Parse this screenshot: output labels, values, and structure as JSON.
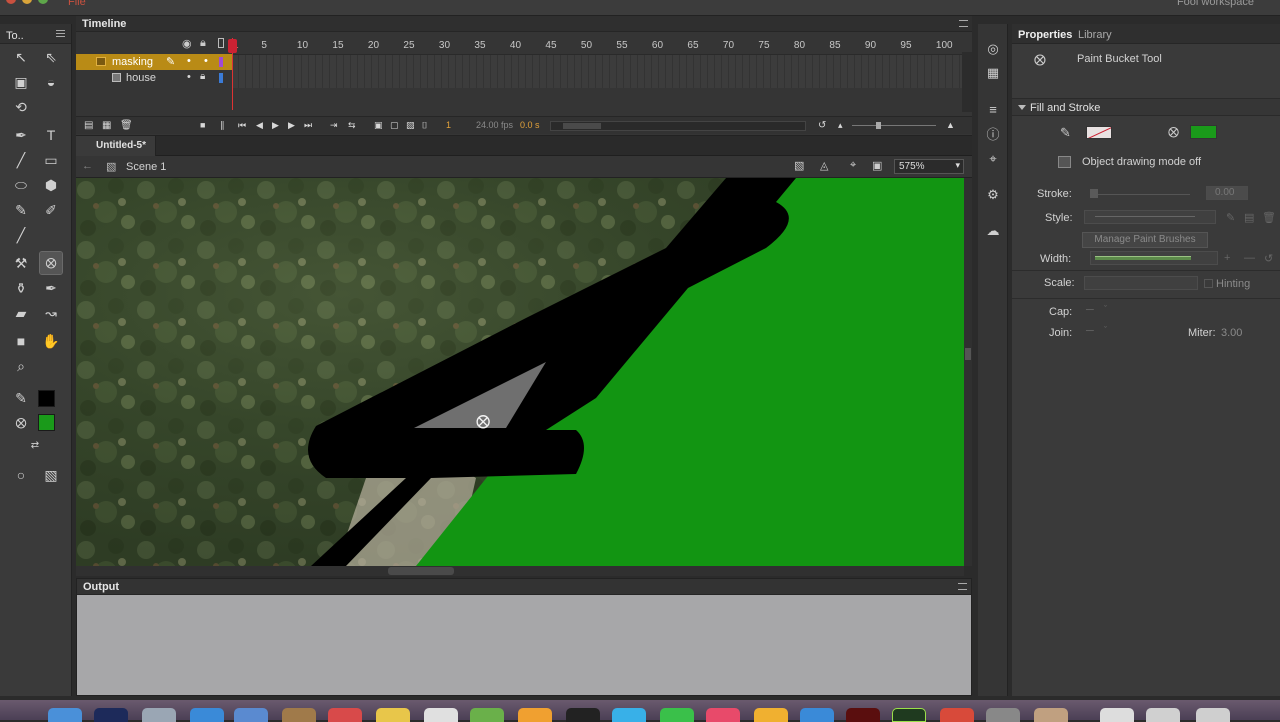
{
  "app": {
    "title": "File",
    "workspace": "Fool workspace"
  },
  "tools": {
    "header": "To..",
    "fill_color": "#000000",
    "stroke_color": "#1a9a1a"
  },
  "timeline": {
    "title": "Timeline",
    "layers": [
      {
        "name": "masking",
        "selected": true
      },
      {
        "name": "house",
        "selected": false
      }
    ],
    "ruler": [
      "1",
      "5",
      "10",
      "15",
      "20",
      "25",
      "30",
      "35",
      "40",
      "45",
      "50",
      "55",
      "60",
      "65",
      "70",
      "75",
      "80",
      "85",
      "90",
      "95",
      "100"
    ],
    "current_frame": "1",
    "fps": "24.00 fps",
    "time": "0.0 s"
  },
  "document": {
    "tab_title": "Untitled-5*",
    "scene": "Scene 1",
    "zoom": "575%"
  },
  "output": {
    "title": "Output"
  },
  "properties": {
    "tabs": [
      "Properties",
      "Library"
    ],
    "tool_name": "Paint Bucket Tool",
    "fill_and_stroke_header": "Fill and Stroke",
    "stroke_swatch_color": "#b25252",
    "fill_swatch_color": "#1a9a1a",
    "object_drawing": "Object drawing mode off",
    "stroke_label": "Stroke:",
    "stroke_value": "0.00",
    "style_label": "Style:",
    "manage_brushes": "Manage Paint Brushes",
    "width_label": "Width:",
    "scale_label": "Scale:",
    "hinting_label": "Hinting",
    "cap_label": "Cap:",
    "join_label": "Join:",
    "miter_label": "Miter:",
    "miter_value": "3.00"
  }
}
